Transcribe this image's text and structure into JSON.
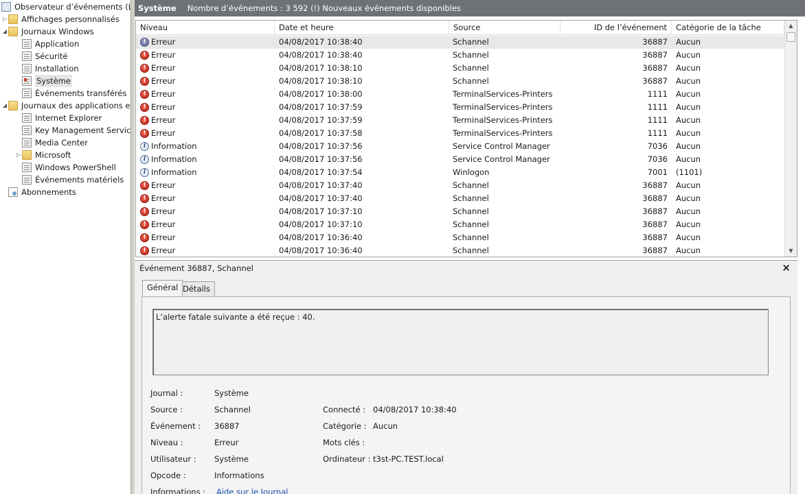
{
  "tree": {
    "root": "Observateur d’événements (Local)",
    "custom_views": "Affichages personnalisés",
    "windows_logs": "Journaux Windows",
    "windows_children": [
      "Application",
      "Sécurité",
      "Installation",
      "Système",
      "Événements transférés"
    ],
    "app_logs": "Journaux des applications et de services",
    "app_children": [
      "Internet Explorer",
      "Key Management Service",
      "Media Center",
      "Microsoft",
      "Windows PowerShell",
      "Événements matériels"
    ],
    "subscriptions": "Abonnements"
  },
  "header": {
    "title": "Système",
    "summary": "Nombre d’événements : 3 592 (!) Nouveaux événements disponibles"
  },
  "columns": {
    "level": "Niveau",
    "date": "Date et heure",
    "source": "Source",
    "id": "ID de l’événement",
    "category": "Catégorie de la tâche"
  },
  "events": [
    {
      "level": "Erreur",
      "kind": "err",
      "date": "04/08/2017 10:38:40",
      "source": "Schannel",
      "id": "36887",
      "category": "Aucun"
    },
    {
      "level": "Erreur",
      "kind": "err",
      "date": "04/08/2017 10:38:40",
      "source": "Schannel",
      "id": "36887",
      "category": "Aucun"
    },
    {
      "level": "Erreur",
      "kind": "err",
      "date": "04/08/2017 10:38:10",
      "source": "Schannel",
      "id": "36887",
      "category": "Aucun"
    },
    {
      "level": "Erreur",
      "kind": "err",
      "date": "04/08/2017 10:38:10",
      "source": "Schannel",
      "id": "36887",
      "category": "Aucun"
    },
    {
      "level": "Erreur",
      "kind": "err",
      "date": "04/08/2017 10:38:00",
      "source": "TerminalServices-Printers",
      "id": "1111",
      "category": "Aucun"
    },
    {
      "level": "Erreur",
      "kind": "err",
      "date": "04/08/2017 10:37:59",
      "source": "TerminalServices-Printers",
      "id": "1111",
      "category": "Aucun"
    },
    {
      "level": "Erreur",
      "kind": "err",
      "date": "04/08/2017 10:37:59",
      "source": "TerminalServices-Printers",
      "id": "1111",
      "category": "Aucun"
    },
    {
      "level": "Erreur",
      "kind": "err",
      "date": "04/08/2017 10:37:58",
      "source": "TerminalServices-Printers",
      "id": "1111",
      "category": "Aucun"
    },
    {
      "level": "Information",
      "kind": "info",
      "date": "04/08/2017 10:37:56",
      "source": "Service Control Manager",
      "id": "7036",
      "category": "Aucun"
    },
    {
      "level": "Information",
      "kind": "info",
      "date": "04/08/2017 10:37:56",
      "source": "Service Control Manager",
      "id": "7036",
      "category": "Aucun"
    },
    {
      "level": "Information",
      "kind": "info",
      "date": "04/08/2017 10:37:54",
      "source": "Winlogon",
      "id": "7001",
      "category": "(1101)"
    },
    {
      "level": "Erreur",
      "kind": "err",
      "date": "04/08/2017 10:37:40",
      "source": "Schannel",
      "id": "36887",
      "category": "Aucun"
    },
    {
      "level": "Erreur",
      "kind": "err",
      "date": "04/08/2017 10:37:40",
      "source": "Schannel",
      "id": "36887",
      "category": "Aucun"
    },
    {
      "level": "Erreur",
      "kind": "err",
      "date": "04/08/2017 10:37:10",
      "source": "Schannel",
      "id": "36887",
      "category": "Aucun"
    },
    {
      "level": "Erreur",
      "kind": "err",
      "date": "04/08/2017 10:37:10",
      "source": "Schannel",
      "id": "36887",
      "category": "Aucun"
    },
    {
      "level": "Erreur",
      "kind": "err",
      "date": "04/08/2017 10:36:40",
      "source": "Schannel",
      "id": "36887",
      "category": "Aucun"
    },
    {
      "level": "Erreur",
      "kind": "err",
      "date": "04/08/2017 10:36:40",
      "source": "Schannel",
      "id": "36887",
      "category": "Aucun"
    }
  ],
  "selected_row": 0,
  "detail": {
    "title": "Événement 36887, Schannel",
    "close": "×",
    "tabs": [
      "Général",
      "Détails"
    ],
    "message": "L’alerte fatale suivante a été reçue : 40.",
    "labels": {
      "journal": "Journal :",
      "source": "Source :",
      "event": "Événement :",
      "level": "Niveau :",
      "user": "Utilisateur :",
      "opcode": "Opcode :",
      "info": "Informations :",
      "connected": "Connecté :",
      "category": "Catégorie :",
      "keywords": "Mots clés :",
      "computer": "Ordinateur :"
    },
    "values": {
      "journal": "Système",
      "source": "Schannel",
      "event": "36887",
      "level": "Erreur",
      "user": "Système",
      "opcode": "Informations",
      "info": "Aide sur le Journal",
      "connected": "04/08/2017 10:38:40",
      "category": "Aucun",
      "keywords": "",
      "computer": "t3st-PC.TEST.local"
    }
  }
}
